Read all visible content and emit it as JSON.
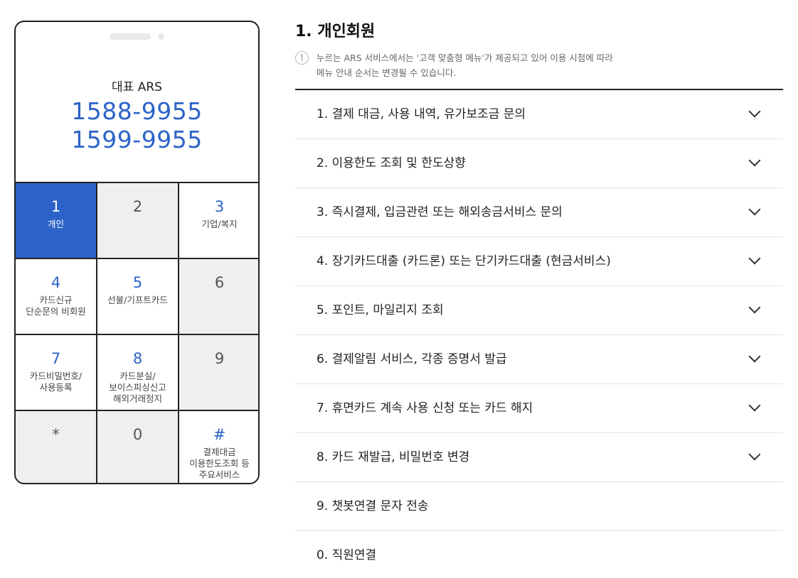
{
  "phone": {
    "ars_label": "대표 ARS",
    "numbers": [
      "1588-9955",
      "1599-9955"
    ],
    "keys": [
      {
        "num": "1",
        "desc": "개인",
        "state": "active"
      },
      {
        "num": "2",
        "desc": "",
        "state": "gray"
      },
      {
        "num": "3",
        "desc": "기업/복지",
        "state": "normal"
      },
      {
        "num": "4",
        "desc": "카드신규\n단순문의 비회원",
        "state": "normal"
      },
      {
        "num": "5",
        "desc": "선불/기프트카드",
        "state": "normal"
      },
      {
        "num": "6",
        "desc": "",
        "state": "gray"
      },
      {
        "num": "7",
        "desc": "카드비밀번호/\n사용등록",
        "state": "normal"
      },
      {
        "num": "8",
        "desc": "카드분실/\n보이스피싱신고\n해외거래정지",
        "state": "normal"
      },
      {
        "num": "9",
        "desc": "",
        "state": "gray"
      },
      {
        "num": "*",
        "desc": "",
        "state": "gray"
      },
      {
        "num": "0",
        "desc": "",
        "state": "gray"
      },
      {
        "num": "#",
        "desc": "결제대금\n이용한도조회 등\n주요서비스",
        "state": "normal"
      }
    ]
  },
  "section": {
    "title": "1. 개인회원",
    "notice_icon": "!",
    "notice": "누르는 ARS 서비스에서는 '고객 맞춤형 메뉴'가 제공되고 있어 이용 시점에 따라\n메뉴 안내 순서는 변경될 수 있습니다.",
    "items": [
      {
        "label": "1. 결제 대금, 사용 내역, 유가보조금 문의",
        "expandable": true
      },
      {
        "label": "2. 이용한도 조회 및 한도상향",
        "expandable": true
      },
      {
        "label": "3. 즉시결제, 입금관련 또는 해외송금서비스 문의",
        "expandable": true
      },
      {
        "label": "4. 장기카드대출 (카드론) 또는 단기카드대출 (현금서비스)",
        "expandable": true
      },
      {
        "label": "5. 포인트, 마일리지 조회",
        "expandable": true
      },
      {
        "label": "6. 결제알림 서비스, 각종 증명서 발급",
        "expandable": true
      },
      {
        "label": "7. 휴면카드 계속 사용 신청 또는 카드 해지",
        "expandable": true
      },
      {
        "label": "8. 카드 재발급, 비밀번호 변경",
        "expandable": true
      },
      {
        "label": "9. 챗봇연결 문자 전송",
        "expandable": false
      },
      {
        "label": "0. 직원연결",
        "expandable": false
      }
    ]
  }
}
